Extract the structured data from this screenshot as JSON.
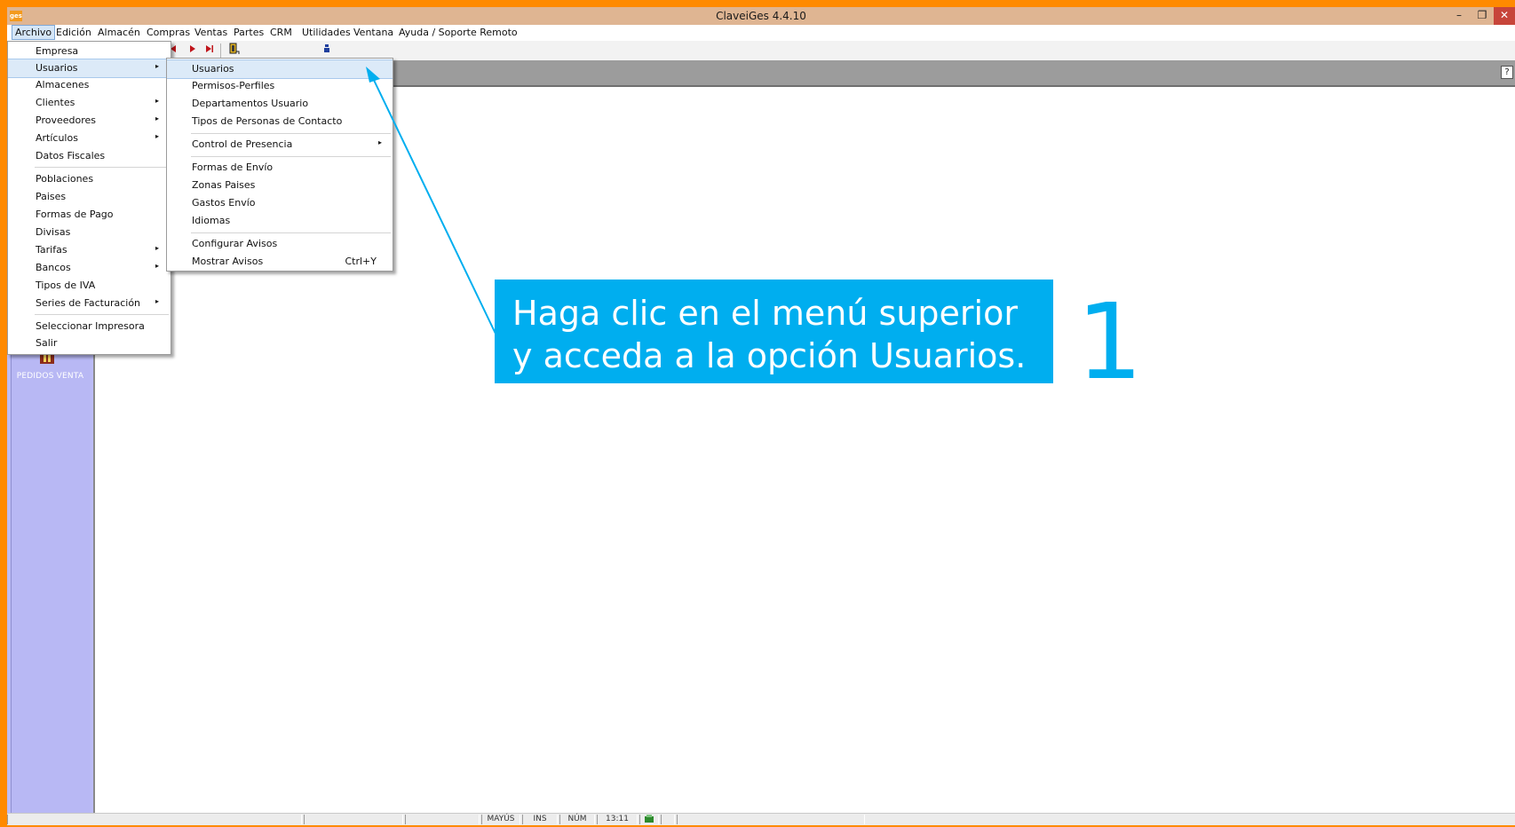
{
  "window": {
    "app_icon_text": "ges",
    "title": "ClaveiGes 4.4.10",
    "min_glyph": "–",
    "restore_glyph": "❐",
    "close_glyph": "✕"
  },
  "menubar": {
    "items": [
      "Archivo",
      "Edición",
      "Almacén",
      "Compras",
      "Ventas",
      "Partes",
      "CRM",
      "Utilidades",
      "Ventana",
      "Ayuda / Soporte Remoto"
    ]
  },
  "toolbar": {
    "icons": [
      "prev-icon",
      "next-icon",
      "last-icon",
      "exit-door-icon",
      "user-icon"
    ]
  },
  "archivo_menu": {
    "items": [
      "Empresa",
      "Usuarios",
      "Almacenes",
      "Clientes",
      "Proveedores",
      "Artículos",
      "Datos Fiscales",
      "Poblaciones",
      "Paises",
      "Formas de Pago",
      "Divisas",
      "Tarifas",
      "Bancos",
      "Tipos de IVA",
      "Series de Facturación",
      "Seleccionar Impresora",
      "Salir"
    ],
    "submenu_arrow": "▸"
  },
  "usuarios_submenu": {
    "items": [
      "Usuarios",
      "Permisos-Perfiles",
      "Departamentos Usuario",
      "Tipos de Personas de Contacto",
      "Control de Presencia",
      "Formas de Envío",
      "Zonas Paises",
      "Gastos Envío",
      "Idiomas",
      "Configurar Avisos",
      "Mostrar Avisos"
    ],
    "shortcut_mostrar_avisos": "Ctrl+Y",
    "submenu_arrow": "▸"
  },
  "sidepanel": {
    "shortcut_label": "PEDIDOS VENTA"
  },
  "statusbar": {
    "mayus": "MAYÚS",
    "ins": "INS",
    "num": "NÚM",
    "time": "13:11"
  },
  "help_glyph": "?",
  "callout": {
    "text": "Haga clic en el menú superior y acceda a la opción Usuarios.",
    "step_number": "1",
    "color": "#00aeef"
  }
}
